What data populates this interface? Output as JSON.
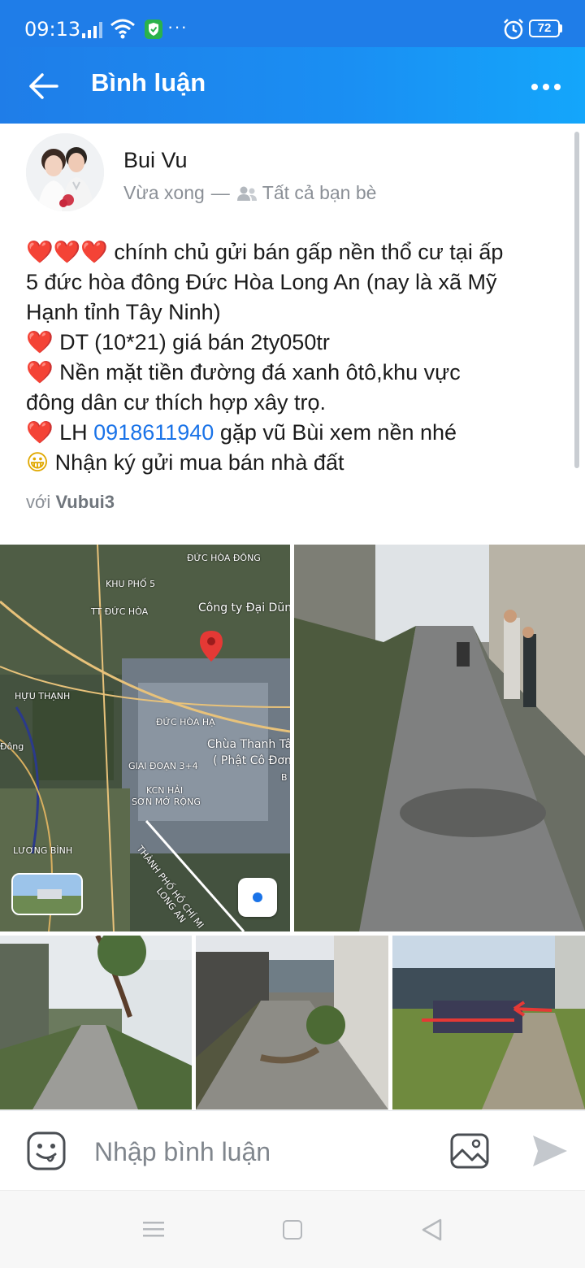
{
  "status_bar": {
    "time": "09:13",
    "battery": "72",
    "icons": [
      "signal-icon",
      "wifi-icon",
      "shield-icon",
      "more-dots",
      "alarm-icon",
      "battery-icon"
    ]
  },
  "header": {
    "title": "Bình luận",
    "back_icon": "arrow-left-icon",
    "more_icon": "more-horizontal-icon"
  },
  "post": {
    "author": "Bui Vu",
    "time": "Vừa xong",
    "separator": "—",
    "privacy": "Tất cả bạn bè",
    "lines": {
      "l1_hearts": "❤️❤️❤️",
      "l1_text": " chính chủ gửi bán gấp nền thổ cư tại ấp",
      "l2_text": "5 đức hòa đông Đức Hòa Long An (nay là xã Mỹ",
      "l3_text": "Hạnh tỉnh Tây Ninh)",
      "l4_heart": "❤️",
      "l4_text": " DT (10*21) giá bán 2ty050tr",
      "l5_heart": "❤️",
      "l5_text": " Nền mặt tiền đường đá xanh ôtô,khu vực",
      "l6_text": "đông dân cư thích hợp xây trọ.",
      "l7_heart": "❤️",
      "l7_prefix": " LH ",
      "l7_phone": "0918611940",
      "l7_suffix": " gặp vũ Bùi xem nền nhé",
      "l8_emoji": "😀",
      "l8_text": " Nhận ký gửi mua bán nhà đất"
    },
    "with_prefix": "với",
    "with_name": "Vubui3",
    "map_labels": {
      "duc_hoa_dong": "ĐỨC HÒA ĐÔNG",
      "khu_pho_5": "KHU PHỐ 5",
      "tt_duc_hoa": "TT ĐỨC HÒA",
      "cong_ty": "Công ty Đại Dũn",
      "huu_thanh": "HỰU THẠNH",
      "dong": "Đông",
      "duc_hoa_ha": "ĐỨC HÒA HẠ",
      "chua": "Chùa Thanh Tâ",
      "phat_co_don": "( Phật Cô Đơn",
      "giai_doan": "GIAI ĐOẠN 3+4",
      "b": "B",
      "kcn": "KCN HẢI",
      "son_mo_rong": "SƠN MỞ RỘNG",
      "luong_binh": "LƯƠNG BÌNH",
      "tp_hcm": "THÀNH PHỐ HỒ CHÍ MI",
      "long_an": "LONG AN"
    }
  },
  "comment_bar": {
    "placeholder": "Nhập bình luận",
    "emoji_icon": "emoji-icon",
    "image_icon": "image-icon",
    "send_icon": "send-icon"
  },
  "nav_bar": {
    "icons": [
      "menu-icon",
      "home-icon",
      "back-icon"
    ]
  },
  "colors": {
    "header_blue": "#1f7de8",
    "link_blue": "#1a73e8",
    "heart_red": "#e0202b",
    "meta_gray": "#8a8f96"
  }
}
